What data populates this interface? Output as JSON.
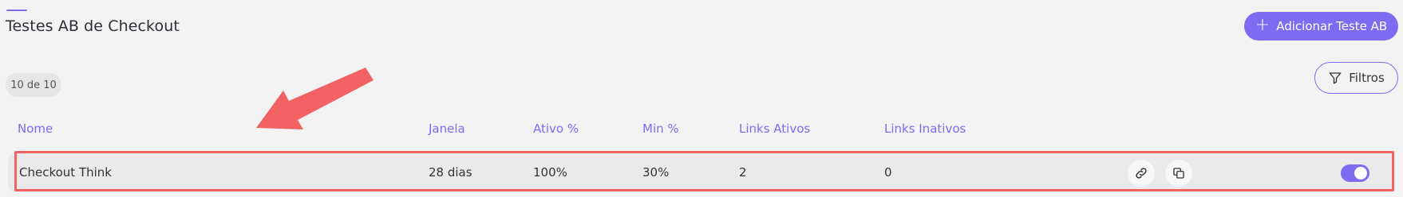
{
  "header": {
    "title": "Testes AB de Checkout",
    "add_button_label": "Adicionar Teste AB",
    "add_button_icon": "plus-icon"
  },
  "toolbar": {
    "count_badge": "10 de 10",
    "filter_label": "Filtros",
    "filter_icon": "filter-icon"
  },
  "table": {
    "columns": [
      "Nome",
      "Janela",
      "Ativo %",
      "Min %",
      "Links Ativos",
      "Links Inativos"
    ],
    "rows": [
      {
        "name": "Checkout Think",
        "window": "28 dias",
        "active_pct": "100%",
        "min_pct": "30%",
        "links_active": "2",
        "links_inactive": "0",
        "enabled": true
      }
    ]
  },
  "colors": {
    "accent": "#7d6cf1",
    "annotation": "#f26263",
    "background": "#f4f3f4"
  },
  "annotations": {
    "arrow": "red-arrow-pointing-to-row",
    "highlight": "red-box-around-row"
  }
}
